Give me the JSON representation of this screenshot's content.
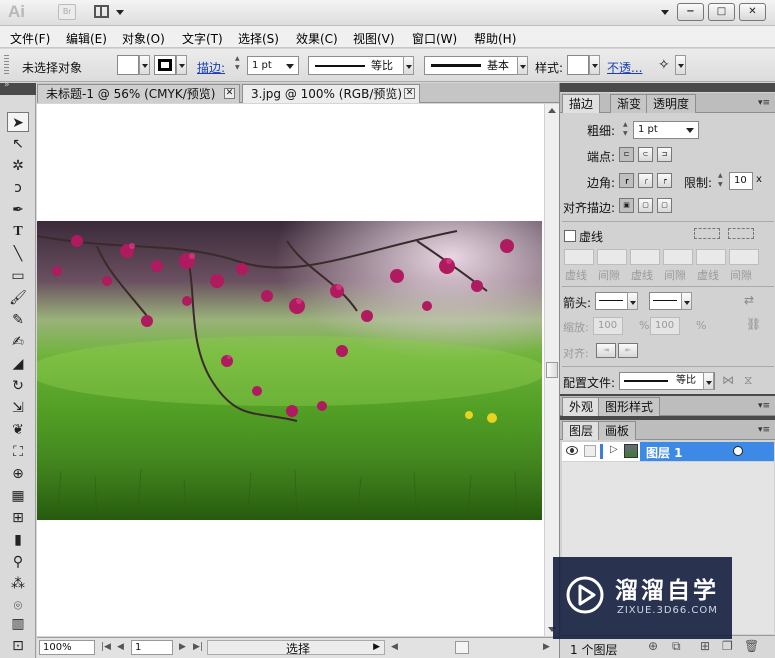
{
  "titlebar": {
    "app_logo": "Ai",
    "bridge_label": "Br",
    "icons": [
      "arrange-documents-icon",
      "chevron-down-icon",
      "minimize-icon",
      "maximize-icon",
      "close-icon"
    ],
    "min_label": "−",
    "max_label": "□",
    "close_label": "✕"
  },
  "menu": [
    "文件(F)",
    "编辑(E)",
    "对象(O)",
    "文字(T)",
    "选择(S)",
    "效果(C)",
    "视图(V)",
    "窗口(W)",
    "帮助(H)"
  ],
  "control_bar": {
    "selection_status": "未选择对象",
    "stroke_link": "描边:",
    "stroke_weight": "1 pt",
    "profile_label": "等比",
    "brush_label": "基本",
    "style_label": "样式:",
    "opacity_link": "不透...",
    "fill_color": "#ffffff",
    "stroke_color": "#000000"
  },
  "doc_tabs": [
    {
      "label": "未标题-1 @ 56% (CMYK/预览)",
      "active": false
    },
    {
      "label": "3.jpg @ 100% (RGB/预览)",
      "active": true
    }
  ],
  "status_bar": {
    "zoom": "100%",
    "artboard": "1",
    "status_label": "选择"
  },
  "stroke_panel": {
    "tabs": [
      "描边",
      "渐变",
      "透明度"
    ],
    "weight_label": "粗细:",
    "weight_value": "1 pt",
    "cap_label": "端点:",
    "corner_label": "边角:",
    "limit_label": "限制:",
    "limit_value": "10",
    "limit_unit": "x",
    "align_label": "对齐描边:",
    "dashed_label": "虚线",
    "dash_labels": [
      "虚线",
      "间隙",
      "虚线",
      "间隙",
      "虚线",
      "间隙"
    ],
    "arrow_label": "箭头:",
    "scale_label": "缩放:",
    "scale_start": "100",
    "scale_end": "100",
    "percent": "%",
    "align_arrow_label": "对齐:",
    "profile_label": "配置文件:",
    "profile_value": "等比"
  },
  "appearance_panel": {
    "tabs": [
      "外观",
      "图形样式"
    ]
  },
  "layers_panel": {
    "tabs": [
      "图层",
      "画板"
    ],
    "layer_name": "图层 1",
    "footer_count": "1 个图层",
    "selected_color": "#3d8ae6"
  },
  "watermark": {
    "brand": "溜溜自学",
    "url": "ZIXUE.3D66.COM"
  }
}
